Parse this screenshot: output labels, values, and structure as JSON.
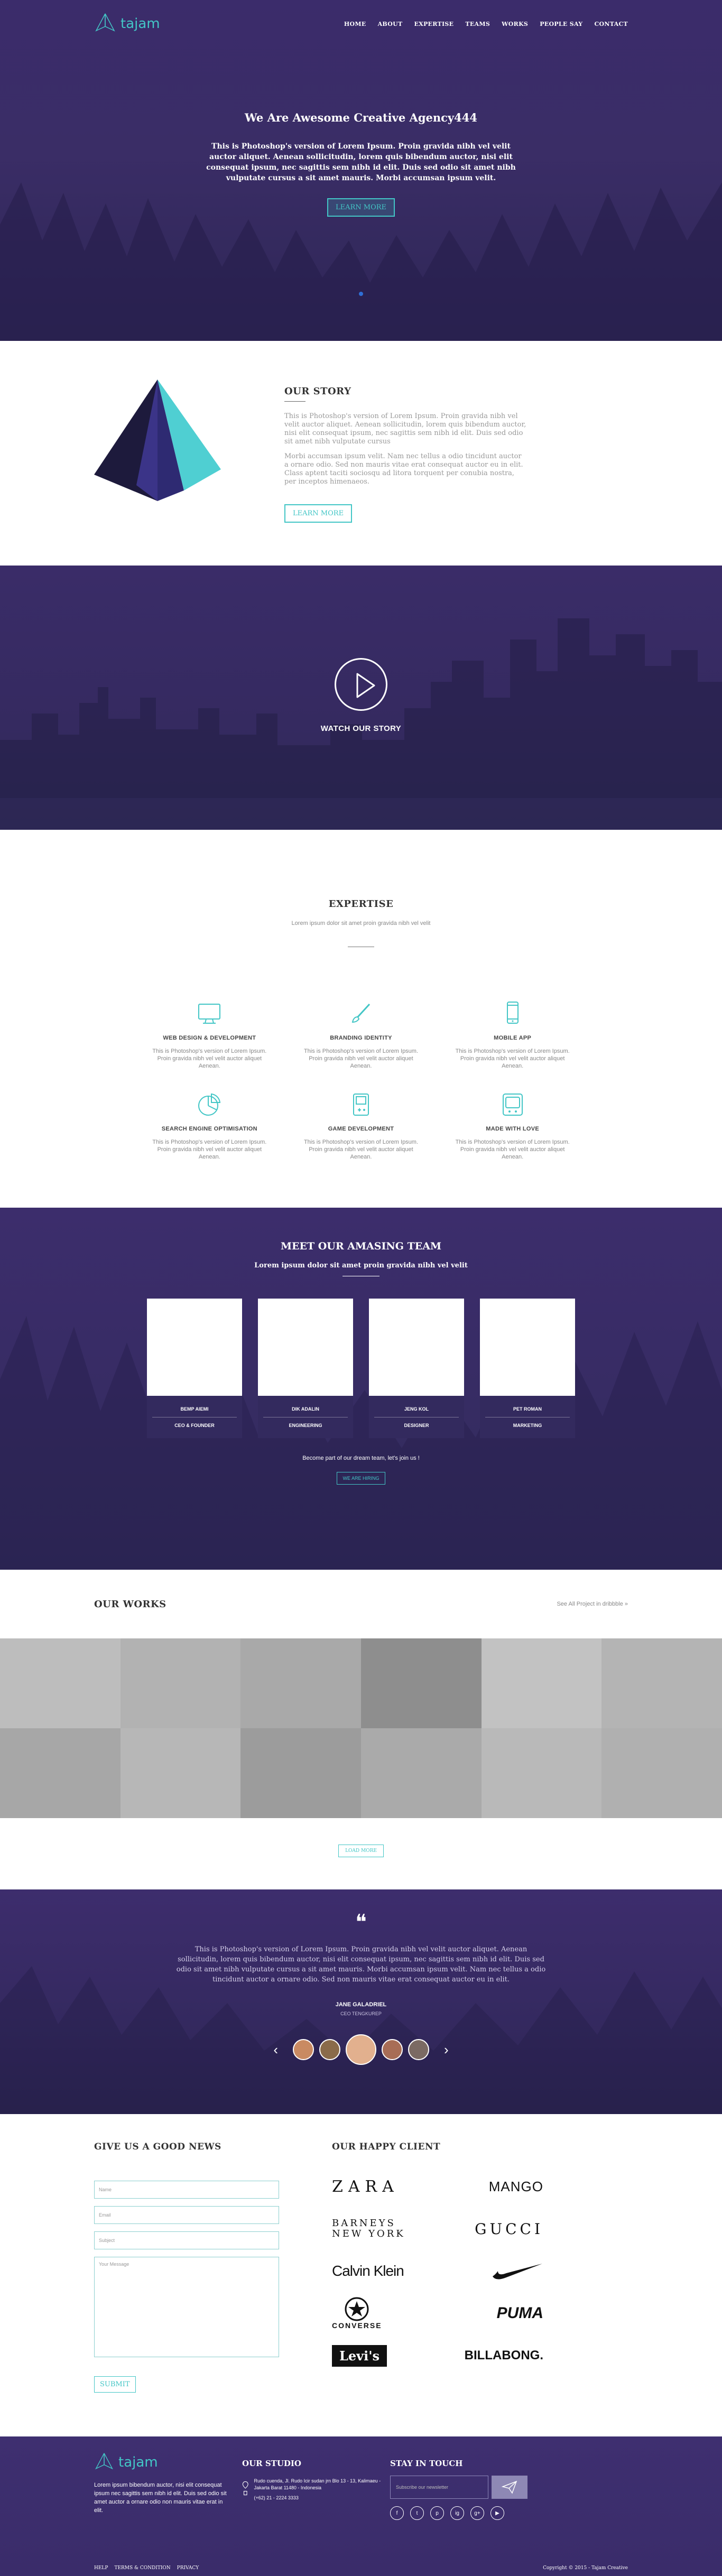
{
  "nav": {
    "logo": "tajam",
    "menu": [
      "HOME",
      "ABOUT",
      "EXPERTISE",
      "TEAMS",
      "WORKS",
      "PEOPLE SAY",
      "CONTACT"
    ]
  },
  "hero": {
    "title": "We Are Awesome Creative Agency444",
    "text": "This is Photoshop's version of Lorem Ipsum. Proin gravida nibh vel velit auctor aliquet. Aenean sollicitudin, lorem quis bibendum auctor, nisi elit consequat ipsum, nec sagittis sem nibh id elit. Duis sed odio sit amet nibh vulputate cursus a sit amet mauris. Morbi accumsan ipsum velit.",
    "button": "LEARN MORE"
  },
  "story": {
    "title": "OUR STORY",
    "p1": "This is Photoshop's version of Lorem Ipsum. Proin gravida nibh vel velit auctor aliquet. Aenean sollicitudin, lorem quis bibendum auctor, nisi elit consequat ipsum, nec sagittis sem nibh id elit. Duis sed odio sit amet nibh vulputate cursus",
    "p2": "Morbi accumsan ipsum velit. Nam nec tellus a odio tincidunt auctor a ornare odio. Sed non mauris vitae erat consequat auctor eu in elit. Class aptent taciti sociosqu ad litora torquent per conubia nostra, per inceptos himenaeos.",
    "button": "LEARN MORE"
  },
  "video": {
    "label": "WATCH OUR STORY"
  },
  "expertise": {
    "title": "EXPERTISE",
    "subtitle": "Lorem ipsum dolor sit amet proin gravida nibh vel velit",
    "items": [
      {
        "icon": "monitor-icon",
        "title": "WEB DESIGN & DEVELOPMENT",
        "text": "This is Photoshop's version of Lorem Ipsum. Proin gravida nibh vel velit auctor aliquet Aenean."
      },
      {
        "icon": "brush-icon",
        "title": "BRANDING IDENTITY",
        "text": "This is Photoshop's version of Lorem Ipsum. Proin gravida nibh vel velit auctor aliquet Aenean."
      },
      {
        "icon": "mobile-icon",
        "title": "MOBILE APP",
        "text": "This is Photoshop's version of Lorem Ipsum. Proin gravida nibh vel velit auctor aliquet Aenean."
      },
      {
        "icon": "pie-chart-icon",
        "title": "SEARCH ENGINE OPTIMISATION",
        "text": "This is Photoshop's version of Lorem Ipsum. Proin gravida nibh vel velit auctor aliquet Aenean."
      },
      {
        "icon": "gamepad-icon",
        "title": "GAME DEVELOPMENT",
        "text": "This is Photoshop's version of Lorem Ipsum. Proin gravida nibh vel velit auctor aliquet Aenean."
      },
      {
        "icon": "tv-icon",
        "title": "MADE WITH LOVE",
        "text": "This is Photoshop's version of Lorem Ipsum. Proin gravida nibh vel velit auctor aliquet Aenean."
      }
    ]
  },
  "team": {
    "title": "MEET OUR AMASING TEAM",
    "subtitle": "Lorem ipsum dolor sit amet proin gravida nibh vel velit",
    "members": [
      {
        "name": "BEMP AIEMI",
        "role": "CEO & FOUNDER"
      },
      {
        "name": "DIK ADALIN",
        "role": "ENGINEERING"
      },
      {
        "name": "JENG KOL",
        "role": "DESIGNER"
      },
      {
        "name": "PET ROMAN",
        "role": "MARKETING"
      }
    ],
    "join_text": "Become part of our dream team, let's join us !",
    "join_button": "WE ARE HIRING"
  },
  "works": {
    "title": "OUR WORKS",
    "link": "See All Project in dribbble »",
    "button": "LOAD MORE",
    "tiles": [
      "#bdbdbd",
      "#b2b2b2",
      "#a9a9a9",
      "#8e8e8e",
      "#c2c2c2",
      "#b4b4b4",
      "#a7a7a7",
      "#b7b7b7",
      "#9c9c9c",
      "#aaaaaa",
      "#b9b9b9",
      "#b0b0b0"
    ]
  },
  "testimonial": {
    "quote_mark": "❝",
    "text": "This is Photoshop's version of Lorem Ipsum. Proin gravida nibh vel velit auctor aliquet. Aenean sollicitudin, lorem quis bibendum auctor, nisi elit consequat ipsum, nec sagittis sem nibh id elit. Duis sed odio sit amet nibh vulputate cursus a sit amet mauris. Morbi accumsan ipsum velit. Nam nec tellus a odio tincidunt auctor a ornare odio. Sed non mauris vitae erat consequat auctor eu in elit.",
    "name": "JANE GALADRIEL",
    "role": "CEO TENGKUREP",
    "prev": "‹",
    "next": "›",
    "avatar_colors": [
      "#c98a62",
      "#8a6b4a",
      "#e2b08e",
      "#a86d56",
      "#7b6a63"
    ]
  },
  "news": {
    "title": "GIVE US A GOOD NEWS",
    "fields": [
      "Name",
      "Email",
      "Subject",
      "Your Message"
    ],
    "button": "SUBMIT"
  },
  "clients": {
    "title": "OUR HAPPY CLIENT",
    "logos": [
      "ZARA",
      "MANGO",
      "BARNEYS NEW YORK",
      "GUCCI",
      "Calvin Klein",
      "Nike",
      "CONVERSE",
      "PUMA",
      "Levi's",
      "BILLABONG."
    ]
  },
  "footer": {
    "logo": "tajam",
    "about": "Lorem ipsum bibendum auctor, nisi elit consequat ipsum nec sagittis sem nibh id elit. Duis sed odio sit amet auctor a ornare odio non mauris vitae erat in elit.",
    "studio_title": "OUR STUDIO",
    "address": "Rudo cuenda, Jl. Rudo Icir sudan jrn Blo 13 - 13, Kalimaeu - Jakarta Barat 11480 - Indonesia",
    "phone": "(+62) 21 - 2224 3333",
    "stay_title": "STAY IN TOUCH",
    "subscribe_placeholder": "Subscribe our newsletter",
    "social": [
      "f",
      "t",
      "p",
      "ig",
      "g+",
      "▶"
    ],
    "links": [
      "HELP",
      "TERMS & CONDITION",
      "PRIVACY"
    ],
    "copyright": "Copyright © 2015 - Tajam Creative"
  },
  "colors": {
    "accent": "#43c6c6",
    "purple": "#3b2c6b"
  }
}
